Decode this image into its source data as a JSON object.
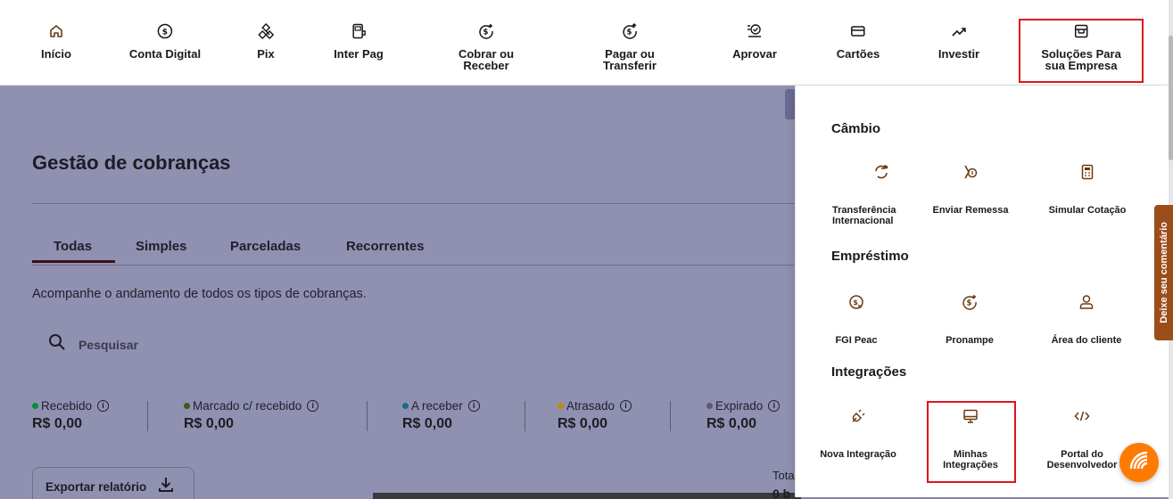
{
  "nav": {
    "items": [
      {
        "label": "Início",
        "icon": "home-icon"
      },
      {
        "label": "Conta Digital",
        "icon": "dollar-circle-icon"
      },
      {
        "label": "Pix",
        "icon": "pix-icon"
      },
      {
        "label": "Inter Pag",
        "icon": "pos-terminal-icon"
      },
      {
        "label": "Cobrar ou\nReceber",
        "icon": "receive-money-icon"
      },
      {
        "label": "Pagar ou\nTransferir",
        "icon": "send-money-icon"
      },
      {
        "label": "Aprovar",
        "icon": "approve-icon"
      },
      {
        "label": "Cartões",
        "icon": "card-icon"
      },
      {
        "label": "Investir",
        "icon": "trend-up-icon"
      },
      {
        "label": "Soluções Para\nsua Empresa",
        "icon": "store-icon"
      }
    ]
  },
  "page": {
    "title": "Gestão de cobranças",
    "tabs": [
      "Todas",
      "Simples",
      "Parceladas",
      "Recorrentes"
    ],
    "description": "Acompanhe o andamento de todos os tipos de cobranças.",
    "search_placeholder": "Pesquisar",
    "stats": [
      {
        "label": "Recebido",
        "value": "R$ 0,00",
        "color": "#0c8a3c"
      },
      {
        "label": "Marcado c/ recebido",
        "value": "R$ 0,00",
        "color": "#3d5a10"
      },
      {
        "label": "A receber",
        "value": "R$ 0,00",
        "color": "#1a6a8a"
      },
      {
        "label": "Atrasado",
        "value": "R$ 0,00",
        "color": "#c08a0a"
      },
      {
        "label": "Expirado",
        "value": "R$ 0,00",
        "color": "#5c5c6e"
      }
    ],
    "info_glyph": "i",
    "export_label": "Exportar relatório",
    "total_label": "Tota",
    "total_value": "0 b"
  },
  "dropdown": {
    "sections": [
      {
        "title": "Câmbio",
        "items": [
          {
            "label": "Transferência\nInternacional",
            "icon": "exchange-icon"
          },
          {
            "label": "Enviar Remessa",
            "icon": "send-remittance-icon"
          },
          {
            "label": "Simular Cotação",
            "icon": "calculator-icon"
          }
        ]
      },
      {
        "title": "Empréstimo",
        "items": [
          {
            "label": "FGI Peac",
            "icon": "loan-coin-icon"
          },
          {
            "label": "Pronampe",
            "icon": "coin-plus-icon"
          },
          {
            "label": "Área do cliente",
            "icon": "user-icon"
          }
        ]
      },
      {
        "title": "Integrações",
        "items": [
          {
            "label": "Nova Integração",
            "icon": "plug-icon"
          },
          {
            "label": "Minhas\nIntegrações",
            "icon": "monitor-icon"
          },
          {
            "label": "Portal do\nDesenvolvedor",
            "icon": "code-icon"
          }
        ]
      }
    ]
  },
  "feedback": {
    "label": "Deixe seu comentário"
  },
  "colors": {
    "accent": "#ff7a00",
    "brand_dark": "#3a1010",
    "highlight": "#e0141e",
    "overlay": "#9091b1"
  }
}
